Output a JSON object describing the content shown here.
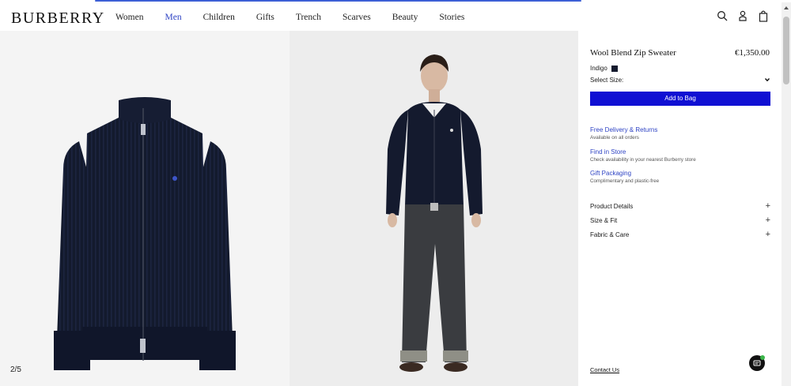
{
  "brand": {
    "logo": "BURBERRY"
  },
  "nav": {
    "items": [
      {
        "label": "Women"
      },
      {
        "label": "Men"
      },
      {
        "label": "Children"
      },
      {
        "label": "Gifts"
      },
      {
        "label": "Trench"
      },
      {
        "label": "Scarves"
      },
      {
        "label": "Beauty"
      },
      {
        "label": "Stories"
      }
    ],
    "active": "Men",
    "active_color": "#2f44c4"
  },
  "header_icons": [
    "search-icon",
    "account-icon",
    "bag-icon"
  ],
  "gallery": {
    "counter": "2/5"
  },
  "product": {
    "title": "Wool Blend Zip Sweater",
    "price": "€1,350.00",
    "color_name": "Indigo",
    "color_swatch": "#141a2e",
    "size_label": "Select Size:",
    "add_to_bag": "Add to Bag",
    "button_color": "#1010d3"
  },
  "services": [
    {
      "title": "Free Delivery & Returns",
      "subtitle": "Available on all orders"
    },
    {
      "title": "Find in Store",
      "subtitle": "Check availability in your nearest Burberry store"
    },
    {
      "title": "Gift Packaging",
      "subtitle": "Complimentary and plastic-free"
    }
  ],
  "accordions": [
    {
      "label": "Product Details"
    },
    {
      "label": "Size & Fit"
    },
    {
      "label": "Fabric & Care"
    }
  ],
  "footer": {
    "contact": "Contact Us"
  }
}
